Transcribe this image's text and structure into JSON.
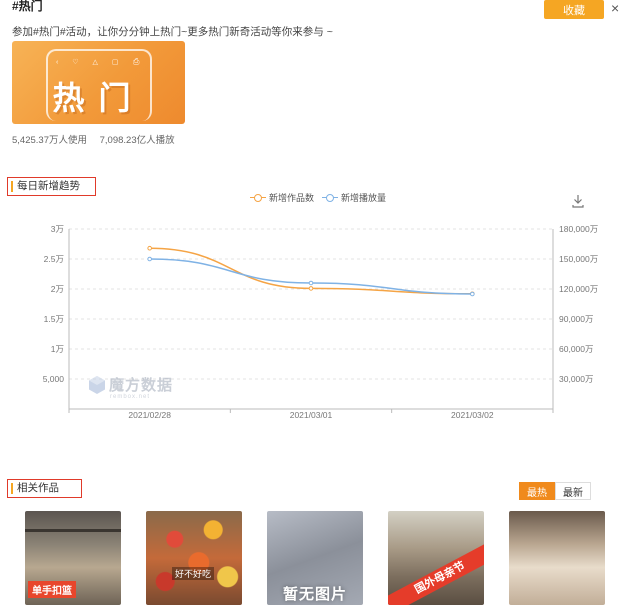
{
  "header": {
    "title": "#热门",
    "favorite_label": "收藏",
    "close_label": "×"
  },
  "topic": {
    "description": "参加#热门#活动，让你分分钟上热门~更多热门新奇活动等你来参与 ~",
    "banner_text": "热门",
    "usage": "5,425.37万人使用",
    "plays": "7,098.23亿人播放"
  },
  "trend_section": {
    "title": "每日新增趋势",
    "download_icon": "download-icon"
  },
  "chart_data": {
    "type": "line",
    "title": "",
    "categories": [
      "2021/02/28",
      "2021/03/01",
      "2021/03/02"
    ],
    "series": [
      {
        "name": "新增作品数",
        "axis": "left",
        "color": "#f5a445",
        "values": [
          26800,
          20100,
          19200
        ]
      },
      {
        "name": "新增播放量",
        "axis": "right",
        "color": "#7fb2e5",
        "values": [
          150000,
          126000,
          115000
        ]
      }
    ],
    "y_left": {
      "min": 0,
      "max": 30000,
      "ticks": [
        5000,
        10000,
        15000,
        20000,
        25000,
        30000
      ],
      "tick_labels": [
        "5,000",
        "1万",
        "1.5万",
        "2万",
        "2.5万",
        "3万"
      ]
    },
    "y_right": {
      "min": 0,
      "max": 180000,
      "ticks": [
        30000,
        60000,
        90000,
        120000,
        150000,
        180000
      ],
      "tick_labels": [
        "30,000万",
        "60,000万",
        "90,000万",
        "120,000万",
        "150,000万",
        "180,000万"
      ]
    },
    "grid": true,
    "legend_position": "top-center"
  },
  "watermark": {
    "text": "魔方数据",
    "sub": "rembox.net"
  },
  "works_section": {
    "title": "相关作品",
    "sort_options": [
      "最热",
      "最新"
    ],
    "active_sort": "最热",
    "items": [
      {
        "tag": "单手扣篮"
      },
      {
        "tag": "好不好吃"
      },
      {
        "tag": "暂无图片"
      },
      {
        "tag": "国外母亲节"
      },
      {
        "tag": ""
      }
    ]
  },
  "colors": {
    "accent": "#f5a623",
    "section_border": "#e03a2a",
    "sort_active": "#f08a1c"
  }
}
